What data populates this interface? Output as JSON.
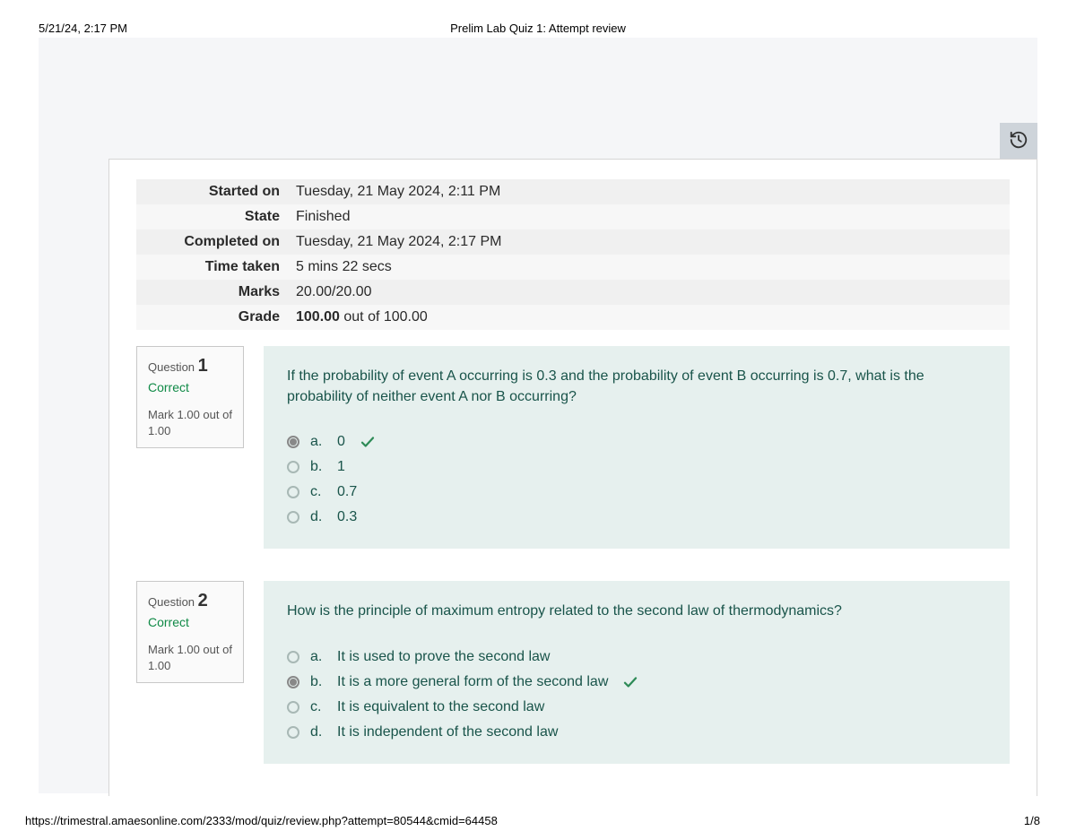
{
  "print": {
    "timestamp": "5/21/24, 2:17 PM",
    "title": "Prelim Lab Quiz 1: Attempt review",
    "url": "https://trimestral.amaesonline.com/2333/mod/quiz/review.php?attempt=80544&cmid=64458",
    "page": "1/8"
  },
  "summary": {
    "started_on_label": "Started on",
    "started_on_value": "Tuesday, 21 May 2024, 2:11 PM",
    "state_label": "State",
    "state_value": "Finished",
    "completed_on_label": "Completed on",
    "completed_on_value": "Tuesday, 21 May 2024, 2:17 PM",
    "time_taken_label": "Time taken",
    "time_taken_value": "5 mins 22 secs",
    "marks_label": "Marks",
    "marks_value": "20.00/20.00",
    "grade_label": "Grade",
    "grade_value_bold": "100.00",
    "grade_value_rest": " out of 100.00"
  },
  "questions": {
    "q1": {
      "label": "Question",
      "number": "1",
      "status": "Correct",
      "mark": "Mark 1.00 out of 1.00",
      "text": "If the probability of event A occurring is 0.3 and the probability of event B occurring is 0.7, what is the probability of neither event A nor B occurring?",
      "answers": {
        "a": {
          "letter": "a.",
          "text": "0"
        },
        "b": {
          "letter": "b.",
          "text": "1"
        },
        "c": {
          "letter": "c.",
          "text": "0.7"
        },
        "d": {
          "letter": "d.",
          "text": "0.3"
        }
      },
      "selected": "a",
      "correct": "a"
    },
    "q2": {
      "label": "Question",
      "number": "2",
      "status": "Correct",
      "mark": "Mark 1.00 out of 1.00",
      "text": "How is the principle of maximum entropy related to the second law of thermodynamics?",
      "answers": {
        "a": {
          "letter": "a.",
          "text": "It is used to prove the second law"
        },
        "b": {
          "letter": "b.",
          "text": "It is a more general form of the second law"
        },
        "c": {
          "letter": "c.",
          "text": "It is equivalent to the second law"
        },
        "d": {
          "letter": "d.",
          "text": "It is independent of the second law"
        }
      },
      "selected": "b",
      "correct": "b"
    }
  }
}
